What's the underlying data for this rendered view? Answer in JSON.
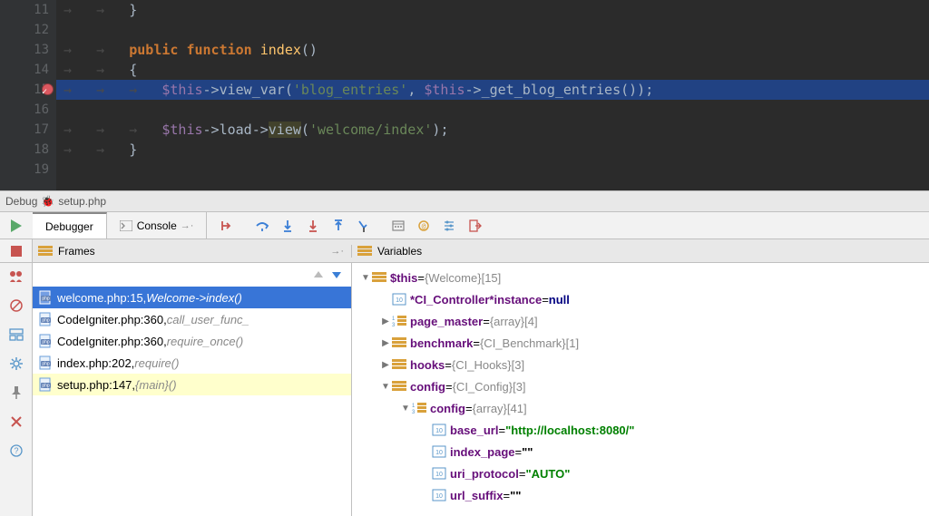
{
  "editor": {
    "lines": [
      {
        "num": "11",
        "indent": 2,
        "tokens": [
          {
            "t": "brace",
            "v": "}"
          }
        ]
      },
      {
        "num": "12",
        "indent": 0,
        "tokens": []
      },
      {
        "num": "13",
        "indent": 2,
        "tokens": [
          {
            "t": "kw-pub",
            "v": "public"
          },
          {
            "t": "space",
            "v": " "
          },
          {
            "t": "kw-func",
            "v": "function"
          },
          {
            "t": "space",
            "v": " "
          },
          {
            "t": "fn-name",
            "v": "index"
          },
          {
            "t": "paren",
            "v": "()"
          }
        ]
      },
      {
        "num": "14",
        "indent": 2,
        "tokens": [
          {
            "t": "brace",
            "v": "{"
          }
        ]
      },
      {
        "num": "15",
        "indent": 3,
        "current": true,
        "breakpoint": true,
        "tokens": [
          {
            "t": "var",
            "v": "$this"
          },
          {
            "t": "arrow",
            "v": "->"
          },
          {
            "t": "method",
            "v": "view_var"
          },
          {
            "t": "paren",
            "v": "("
          },
          {
            "t": "str",
            "v": "'blog_entries'"
          },
          {
            "t": "paren",
            "v": ", "
          },
          {
            "t": "var",
            "v": "$this"
          },
          {
            "t": "arrow",
            "v": "->"
          },
          {
            "t": "method",
            "v": "_get_blog_entries"
          },
          {
            "t": "paren",
            "v": "())"
          },
          {
            "t": "semi",
            "v": ";"
          }
        ]
      },
      {
        "num": "16",
        "indent": 0,
        "tokens": []
      },
      {
        "num": "17",
        "indent": 3,
        "tokens": [
          {
            "t": "var",
            "v": "$this"
          },
          {
            "t": "arrow",
            "v": "->"
          },
          {
            "t": "method",
            "v": "load"
          },
          {
            "t": "arrow",
            "v": "->"
          },
          {
            "t": "method-hl",
            "v": "view"
          },
          {
            "t": "paren",
            "v": "("
          },
          {
            "t": "str",
            "v": "'welcome/index'"
          },
          {
            "t": "paren",
            "v": ")"
          },
          {
            "t": "semi",
            "v": ";"
          }
        ]
      },
      {
        "num": "18",
        "indent": 2,
        "tokens": [
          {
            "t": "brace",
            "v": "}"
          }
        ]
      },
      {
        "num": "19",
        "indent": 0,
        "tokens": []
      }
    ]
  },
  "debug_header": {
    "label": "Debug",
    "file": "setup.php"
  },
  "tabs": {
    "debugger": "Debugger",
    "console": "Console"
  },
  "frames_label": "Frames",
  "variables_label": "Variables",
  "frames": [
    {
      "file": "welcome.php:15",
      "meta": "Welcome->index()",
      "selected": true
    },
    {
      "file": "CodeIgniter.php:360",
      "meta": "call_user_func_"
    },
    {
      "file": "CodeIgniter.php:360",
      "meta": "require_once()"
    },
    {
      "file": "index.php:202",
      "meta": "require()"
    },
    {
      "file": "setup.php:147",
      "meta": "{main}()",
      "highlight": true
    }
  ],
  "variables": [
    {
      "depth": 0,
      "toggle": "▼",
      "ico": "obj",
      "name": "$this",
      "eq": " = ",
      "type": "{Welcome}",
      "count": " [15]"
    },
    {
      "depth": 1,
      "toggle": "",
      "ico": "num",
      "name": "*CI_Controller*instance",
      "ci": true,
      "eq": " = ",
      "nullv": "null"
    },
    {
      "depth": 1,
      "toggle": "▶",
      "ico": "arr",
      "name": "page_master",
      "eq": " = ",
      "type": "{array}",
      "count": " [4]"
    },
    {
      "depth": 1,
      "toggle": "▶",
      "ico": "obj",
      "name": "benchmark",
      "eq": " = ",
      "type": "{CI_Benchmark}",
      "count": " [1]"
    },
    {
      "depth": 1,
      "toggle": "▶",
      "ico": "obj",
      "name": "hooks",
      "eq": " = ",
      "type": "{CI_Hooks}",
      "count": " [3]"
    },
    {
      "depth": 1,
      "toggle": "▼",
      "ico": "obj",
      "name": "config",
      "eq": " = ",
      "type": "{CI_Config}",
      "count": " [3]"
    },
    {
      "depth": 2,
      "toggle": "▼",
      "ico": "arr",
      "name": "config",
      "eq": " = ",
      "type": "{array}",
      "count": " [41]"
    },
    {
      "depth": 3,
      "toggle": "",
      "ico": "num",
      "name": "base_url",
      "eq": " = ",
      "strv": "\"http://localhost:8080/\"",
      "green": true
    },
    {
      "depth": 3,
      "toggle": "",
      "ico": "num",
      "name": "index_page",
      "eq": " = ",
      "strv": "\"\""
    },
    {
      "depth": 3,
      "toggle": "",
      "ico": "num",
      "name": "uri_protocol",
      "eq": " = ",
      "strv": "\"AUTO\"",
      "green": true
    },
    {
      "depth": 3,
      "toggle": "",
      "ico": "num",
      "name": "url_suffix",
      "eq": " = ",
      "strv": "\"\""
    }
  ]
}
